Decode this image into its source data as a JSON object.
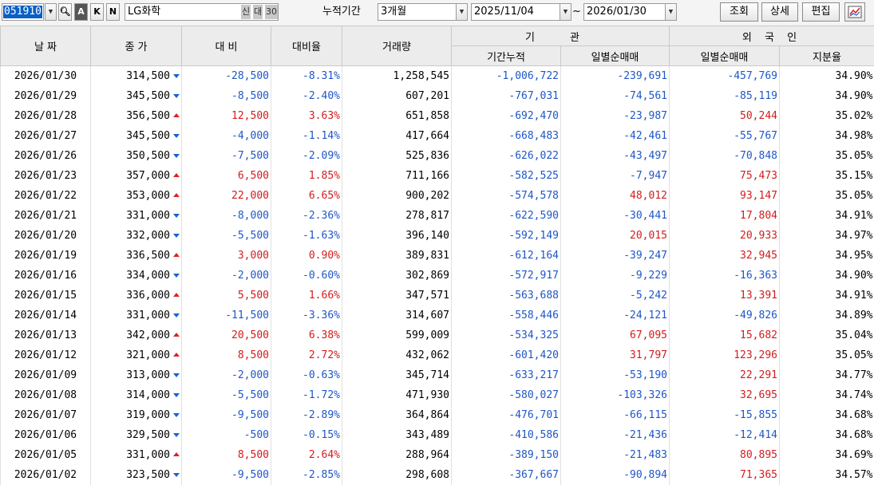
{
  "toolbar": {
    "code": "051910",
    "btn_a": "A",
    "btn_k": "K",
    "btn_n": "N",
    "stock_name": "LG화학",
    "tag_sin": "신",
    "tag_dae": "대",
    "tag_30": "30",
    "period_label": "누적기간",
    "period_value": "3개월",
    "date_from": "2025/11/04",
    "tilde": "~",
    "date_to": "2026/01/30",
    "search_label": "조회",
    "detail_label": "상세",
    "edit_label": "편집",
    "chart_icon": "chart-icon"
  },
  "table": {
    "headers": {
      "date": "날 짜",
      "close": "종 가",
      "change": "대 비",
      "change_rate": "대비율",
      "volume": "거래량",
      "inst_group": "기 관",
      "inst_cum": "기간누적",
      "inst_daily": "일별순매매",
      "foreign_group": "외 국 인",
      "foreign_daily": "일별순매매",
      "foreign_ratio": "지분율"
    },
    "rows": [
      {
        "date": "2026/01/30",
        "close": "314,500",
        "dir": "down",
        "change": "-28,500",
        "rate": "-8.31%",
        "volume": "1,258,545",
        "inst_cum": "-1,006,722",
        "inst_daily": "-239,691",
        "frgn_daily": "-457,769",
        "frgn_ratio": "34.90%"
      },
      {
        "date": "2026/01/29",
        "close": "345,500",
        "dir": "down",
        "change": "-8,500",
        "rate": "-2.40%",
        "volume": "607,201",
        "inst_cum": "-767,031",
        "inst_daily": "-74,561",
        "frgn_daily": "-85,119",
        "frgn_ratio": "34.90%"
      },
      {
        "date": "2026/01/28",
        "close": "356,500",
        "dir": "up",
        "change": "12,500",
        "rate": "3.63%",
        "volume": "651,858",
        "inst_cum": "-692,470",
        "inst_daily": "-23,987",
        "frgn_daily": "50,244",
        "frgn_ratio": "35.02%"
      },
      {
        "date": "2026/01/27",
        "close": "345,500",
        "dir": "down",
        "change": "-4,000",
        "rate": "-1.14%",
        "volume": "417,664",
        "inst_cum": "-668,483",
        "inst_daily": "-42,461",
        "frgn_daily": "-55,767",
        "frgn_ratio": "34.98%"
      },
      {
        "date": "2026/01/26",
        "close": "350,500",
        "dir": "down",
        "change": "-7,500",
        "rate": "-2.09%",
        "volume": "525,836",
        "inst_cum": "-626,022",
        "inst_daily": "-43,497",
        "frgn_daily": "-70,848",
        "frgn_ratio": "35.05%"
      },
      {
        "date": "2026/01/23",
        "close": "357,000",
        "dir": "up",
        "change": "6,500",
        "rate": "1.85%",
        "volume": "711,166",
        "inst_cum": "-582,525",
        "inst_daily": "-7,947",
        "frgn_daily": "75,473",
        "frgn_ratio": "35.15%"
      },
      {
        "date": "2026/01/22",
        "close": "353,000",
        "dir": "up",
        "change": "22,000",
        "rate": "6.65%",
        "volume": "900,202",
        "inst_cum": "-574,578",
        "inst_daily": "48,012",
        "frgn_daily": "93,147",
        "frgn_ratio": "35.05%"
      },
      {
        "date": "2026/01/21",
        "close": "331,000",
        "dir": "down",
        "change": "-8,000",
        "rate": "-2.36%",
        "volume": "278,817",
        "inst_cum": "-622,590",
        "inst_daily": "-30,441",
        "frgn_daily": "17,804",
        "frgn_ratio": "34.91%"
      },
      {
        "date": "2026/01/20",
        "close": "332,000",
        "dir": "down",
        "change": "-5,500",
        "rate": "-1.63%",
        "volume": "396,140",
        "inst_cum": "-592,149",
        "inst_daily": "20,015",
        "frgn_daily": "20,933",
        "frgn_ratio": "34.97%"
      },
      {
        "date": "2026/01/19",
        "close": "336,500",
        "dir": "up",
        "change": "3,000",
        "rate": "0.90%",
        "volume": "389,831",
        "inst_cum": "-612,164",
        "inst_daily": "-39,247",
        "frgn_daily": "32,945",
        "frgn_ratio": "34.95%"
      },
      {
        "date": "2026/01/16",
        "close": "334,000",
        "dir": "down",
        "change": "-2,000",
        "rate": "-0.60%",
        "volume": "302,869",
        "inst_cum": "-572,917",
        "inst_daily": "-9,229",
        "frgn_daily": "-16,363",
        "frgn_ratio": "34.90%"
      },
      {
        "date": "2026/01/15",
        "close": "336,000",
        "dir": "up",
        "change": "5,500",
        "rate": "1.66%",
        "volume": "347,571",
        "inst_cum": "-563,688",
        "inst_daily": "-5,242",
        "frgn_daily": "13,391",
        "frgn_ratio": "34.91%"
      },
      {
        "date": "2026/01/14",
        "close": "331,000",
        "dir": "down",
        "change": "-11,500",
        "rate": "-3.36%",
        "volume": "314,607",
        "inst_cum": "-558,446",
        "inst_daily": "-24,121",
        "frgn_daily": "-49,826",
        "frgn_ratio": "34.89%"
      },
      {
        "date": "2026/01/13",
        "close": "342,000",
        "dir": "up",
        "change": "20,500",
        "rate": "6.38%",
        "volume": "599,009",
        "inst_cum": "-534,325",
        "inst_daily": "67,095",
        "frgn_daily": "15,682",
        "frgn_ratio": "35.04%"
      },
      {
        "date": "2026/01/12",
        "close": "321,000",
        "dir": "up",
        "change": "8,500",
        "rate": "2.72%",
        "volume": "432,062",
        "inst_cum": "-601,420",
        "inst_daily": "31,797",
        "frgn_daily": "123,296",
        "frgn_ratio": "35.05%"
      },
      {
        "date": "2026/01/09",
        "close": "313,000",
        "dir": "down",
        "change": "-2,000",
        "rate": "-0.63%",
        "volume": "345,714",
        "inst_cum": "-633,217",
        "inst_daily": "-53,190",
        "frgn_daily": "22,291",
        "frgn_ratio": "34.77%"
      },
      {
        "date": "2026/01/08",
        "close": "314,000",
        "dir": "down",
        "change": "-5,500",
        "rate": "-1.72%",
        "volume": "471,930",
        "inst_cum": "-580,027",
        "inst_daily": "-103,326",
        "frgn_daily": "32,695",
        "frgn_ratio": "34.74%"
      },
      {
        "date": "2026/01/07",
        "close": "319,000",
        "dir": "down",
        "change": "-9,500",
        "rate": "-2.89%",
        "volume": "364,864",
        "inst_cum": "-476,701",
        "inst_daily": "-66,115",
        "frgn_daily": "-15,855",
        "frgn_ratio": "34.68%"
      },
      {
        "date": "2026/01/06",
        "close": "329,500",
        "dir": "down",
        "change": "-500",
        "rate": "-0.15%",
        "volume": "343,489",
        "inst_cum": "-410,586",
        "inst_daily": "-21,436",
        "frgn_daily": "-12,414",
        "frgn_ratio": "34.68%"
      },
      {
        "date": "2026/01/05",
        "close": "331,000",
        "dir": "up",
        "change": "8,500",
        "rate": "2.64%",
        "volume": "288,964",
        "inst_cum": "-389,150",
        "inst_daily": "-21,483",
        "frgn_daily": "80,895",
        "frgn_ratio": "34.69%"
      },
      {
        "date": "2026/01/02",
        "close": "323,500",
        "dir": "down",
        "change": "-9,500",
        "rate": "-2.85%",
        "volume": "298,608",
        "inst_cum": "-367,667",
        "inst_daily": "-90,894",
        "frgn_daily": "71,365",
        "frgn_ratio": "34.57%"
      }
    ]
  }
}
